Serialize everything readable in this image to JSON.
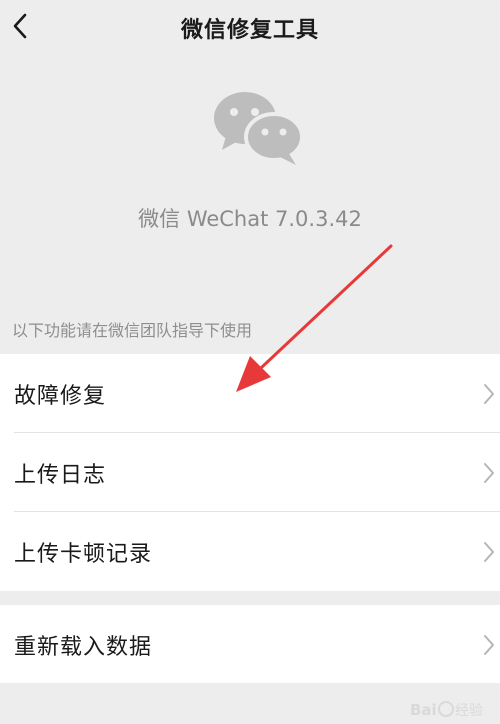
{
  "nav": {
    "title": "微信修复工具",
    "back_icon": "chevron-left-icon"
  },
  "app": {
    "logo_icon": "wechat-logo-icon",
    "version_text": "微信 WeChat 7.0.3.42"
  },
  "section": {
    "hint": "以下功能请在微信团队指导下使用"
  },
  "menu_group_1": [
    {
      "label": "故障修复"
    },
    {
      "label": "上传日志"
    },
    {
      "label": "上传卡顿记录"
    }
  ],
  "menu_group_2": [
    {
      "label": "重新载入数据"
    }
  ],
  "colors": {
    "background": "#ededed",
    "card": "#ffffff",
    "annotation_arrow": "#e8393a",
    "logo": "#bdbdbd"
  },
  "watermark": {
    "text": "Baidu经验"
  }
}
